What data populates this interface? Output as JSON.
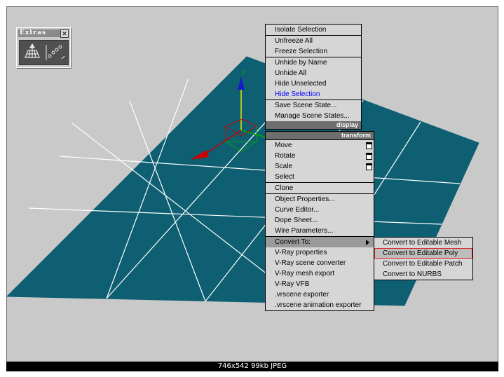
{
  "extras_toolbar": {
    "title": "Extras",
    "close_glyph": "✕",
    "buttons": [
      {
        "icon": "grid-icon"
      },
      {
        "icon": "array-icon"
      }
    ]
  },
  "viewport": {
    "plane_color": "#0e5f72",
    "grid_color": "#ffffff",
    "background": "#c9c9c9",
    "gizmo": {
      "axis_z_label": "z",
      "x_color": "#cc0000",
      "y_color": "#00aa00",
      "z_color": "#0000cc"
    }
  },
  "quad_menu": {
    "display_items": [
      {
        "label": "Isolate Selection"
      },
      {
        "label": "Unfreeze All"
      },
      {
        "label": "Freeze Selection"
      },
      {
        "label": "Unhide by Name"
      },
      {
        "label": "Unhide All"
      },
      {
        "label": "Hide Unselected"
      },
      {
        "label": "Hide Selection"
      },
      {
        "label": "Save Scene State..."
      },
      {
        "label": "Manage Scene States..."
      }
    ],
    "display_header": "display",
    "transform_header": "transform",
    "transform_items": [
      {
        "label": "Move"
      },
      {
        "label": "Rotate"
      },
      {
        "label": "Scale"
      },
      {
        "label": "Select"
      },
      {
        "label": "Clone"
      },
      {
        "label": "Object Properties..."
      },
      {
        "label": "Curve Editor..."
      },
      {
        "label": "Dope Sheet..."
      },
      {
        "label": "Wire Parameters..."
      },
      {
        "label": "Convert To:"
      },
      {
        "label": "V-Ray properties"
      },
      {
        "label": "V-Ray scene converter"
      },
      {
        "label": "V-Ray mesh export"
      },
      {
        "label": "V-Ray VFB"
      },
      {
        "label": ".vrscene exporter"
      },
      {
        "label": ".vrscene animation exporter"
      }
    ]
  },
  "convert_submenu": {
    "items": [
      {
        "label": "Convert to Editable Mesh"
      },
      {
        "label": "Convert to Editable Poly"
      },
      {
        "label": "Convert to Editable Patch"
      },
      {
        "label": "Convert to NURBS"
      }
    ],
    "selected_index": 1,
    "selection_color": "#d9262b"
  },
  "status_bar": {
    "text": "746x542  99kb  JPEG"
  }
}
